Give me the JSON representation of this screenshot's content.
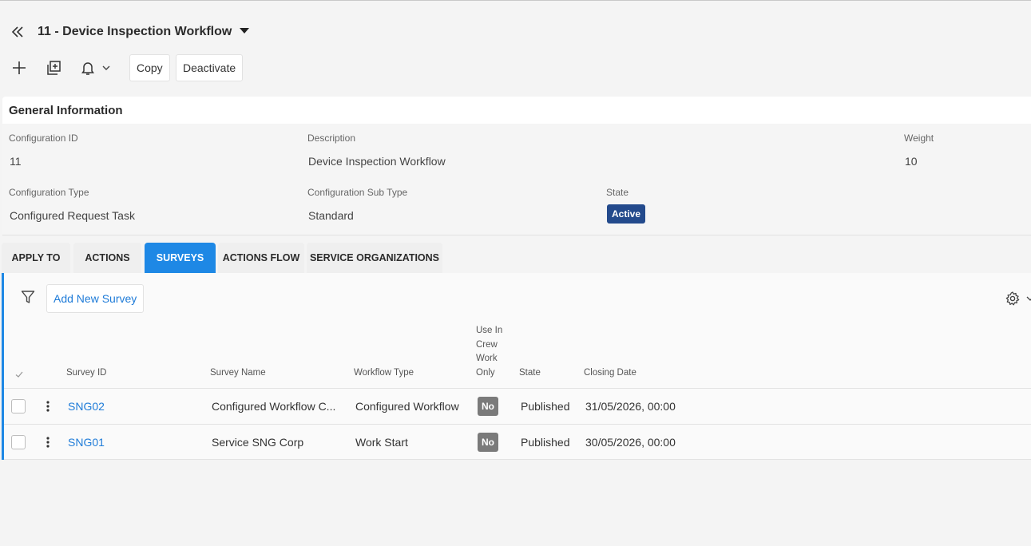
{
  "header": {
    "title": "11 - Device Inspection Workflow"
  },
  "toolbar": {
    "copy_label": "Copy",
    "deactivate_label": "Deactivate"
  },
  "general_info": {
    "heading": "General Information",
    "config_id_label": "Configuration ID",
    "config_id_value": "11",
    "description_label": "Description",
    "description_value": "Device Inspection Workflow",
    "weight_label": "Weight",
    "weight_value": "10",
    "config_type_label": "Configuration Type",
    "config_type_value": "Configured Request Task",
    "config_subtype_label": "Configuration Sub Type",
    "config_subtype_value": "Standard",
    "state_label": "State",
    "state_value": "Active",
    "state_color": "#234a8c"
  },
  "tabs": [
    {
      "label": "APPLY TO"
    },
    {
      "label": "ACTIONS"
    },
    {
      "label": "SURVEYS",
      "active": true
    },
    {
      "label": "ACTIONS FLOW"
    },
    {
      "label": "SERVICE ORGANIZATIONS"
    }
  ],
  "surveys": {
    "add_button_label": "Add New Survey",
    "columns": {
      "survey_id": "Survey ID",
      "survey_name": "Survey Name",
      "workflow_type": "Workflow Type",
      "use_in_crew_1": "Use In",
      "use_in_crew_2": "Crew",
      "use_in_crew_3": "Work",
      "use_in_crew_4": "Only",
      "state": "State",
      "closing_date": "Closing Date"
    },
    "rows": [
      {
        "survey_id": "SNG02",
        "survey_name": "Configured Workflow C...",
        "workflow_type": "Configured Workflow",
        "use_in_crew": "No",
        "state": "Published",
        "closing_date": "31/05/2026, 00:00"
      },
      {
        "survey_id": "SNG01",
        "survey_name": "Service SNG Corp",
        "workflow_type": "Work Start",
        "use_in_crew": "No",
        "state": "Published",
        "closing_date": "30/05/2026, 00:00"
      }
    ]
  },
  "colors": {
    "accent": "#1e88e5",
    "link": "#1e7bd8",
    "badge_no": "#7a7a7a"
  }
}
